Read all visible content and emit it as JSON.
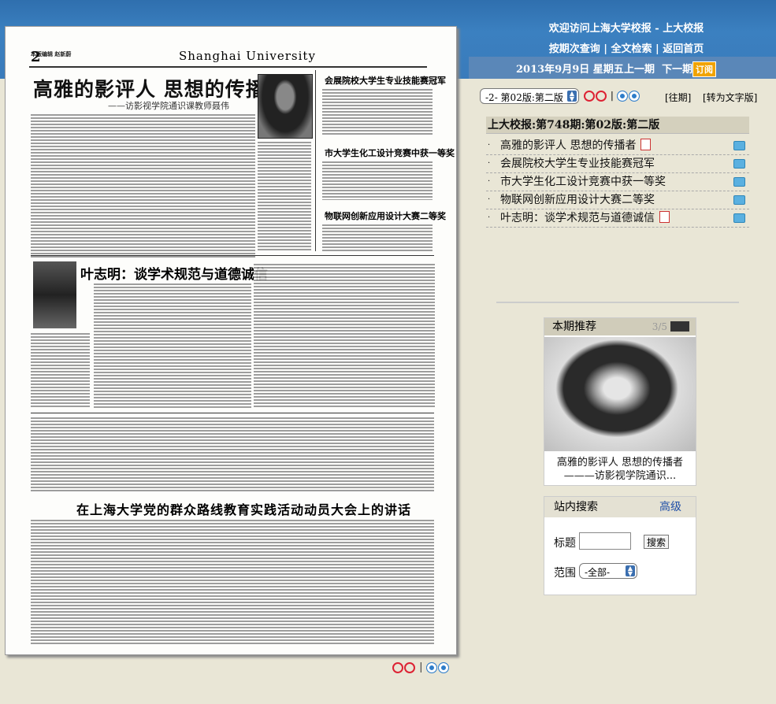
{
  "header": {
    "welcome": "欢迎访问上海大学校报 - 上大校报",
    "links": [
      "按期次查询",
      "全文检索",
      "返回首页"
    ],
    "date": "2013年9月9日 星期五",
    "prev_issue": "上一期",
    "next_issue": "下一期",
    "subscribe": "订阅"
  },
  "newspaper": {
    "page_no": "2",
    "masthead": "Shanghai   University",
    "top_label": "本版编辑 赵新蔚",
    "headline1": "高雅的影评人   思想的传播者",
    "subtitle1": "——访影视学院通识课教师聂伟",
    "headline2": "叶志明：谈学术规范与道德诚信",
    "sec1": "会展院校大学生专业技能赛冠军",
    "sec2": "市大学生化工设计竞赛中获一等奖",
    "sec3": "物联网创新应用设计大赛二等奖",
    "headline3": "在上海大学党的群众路线教育实践活动动员大会上的讲话"
  },
  "toolbar": {
    "page_select": "-2- 第02版:第二版",
    "past": "[往期]",
    "to_text": "[转为文字版]"
  },
  "issue": {
    "title": "上大校报:第748期:第02版:第二版",
    "articles": [
      {
        "title": "高雅的影评人 思想的传播者",
        "has_pdf": true
      },
      {
        "title": "会展院校大学生专业技能赛冠军",
        "has_pdf": false
      },
      {
        "title": "市大学生化工设计竞赛中获一等奖",
        "has_pdf": false
      },
      {
        "title": "物联网创新应用设计大赛二等奖",
        "has_pdf": false
      },
      {
        "title": "叶志明：谈学术规范与道德诚信",
        "has_pdf": true
      }
    ]
  },
  "recommend": {
    "title": "本期推荐",
    "counter": "3/5",
    "caption1": "高雅的影评人 思想的传播者",
    "caption2": "———访影视学院通识..."
  },
  "search": {
    "title": "站内搜索",
    "advanced": "高级",
    "title_label": "标题",
    "button": "搜索",
    "scope_label": "范围",
    "scope_value": "-全部-"
  }
}
